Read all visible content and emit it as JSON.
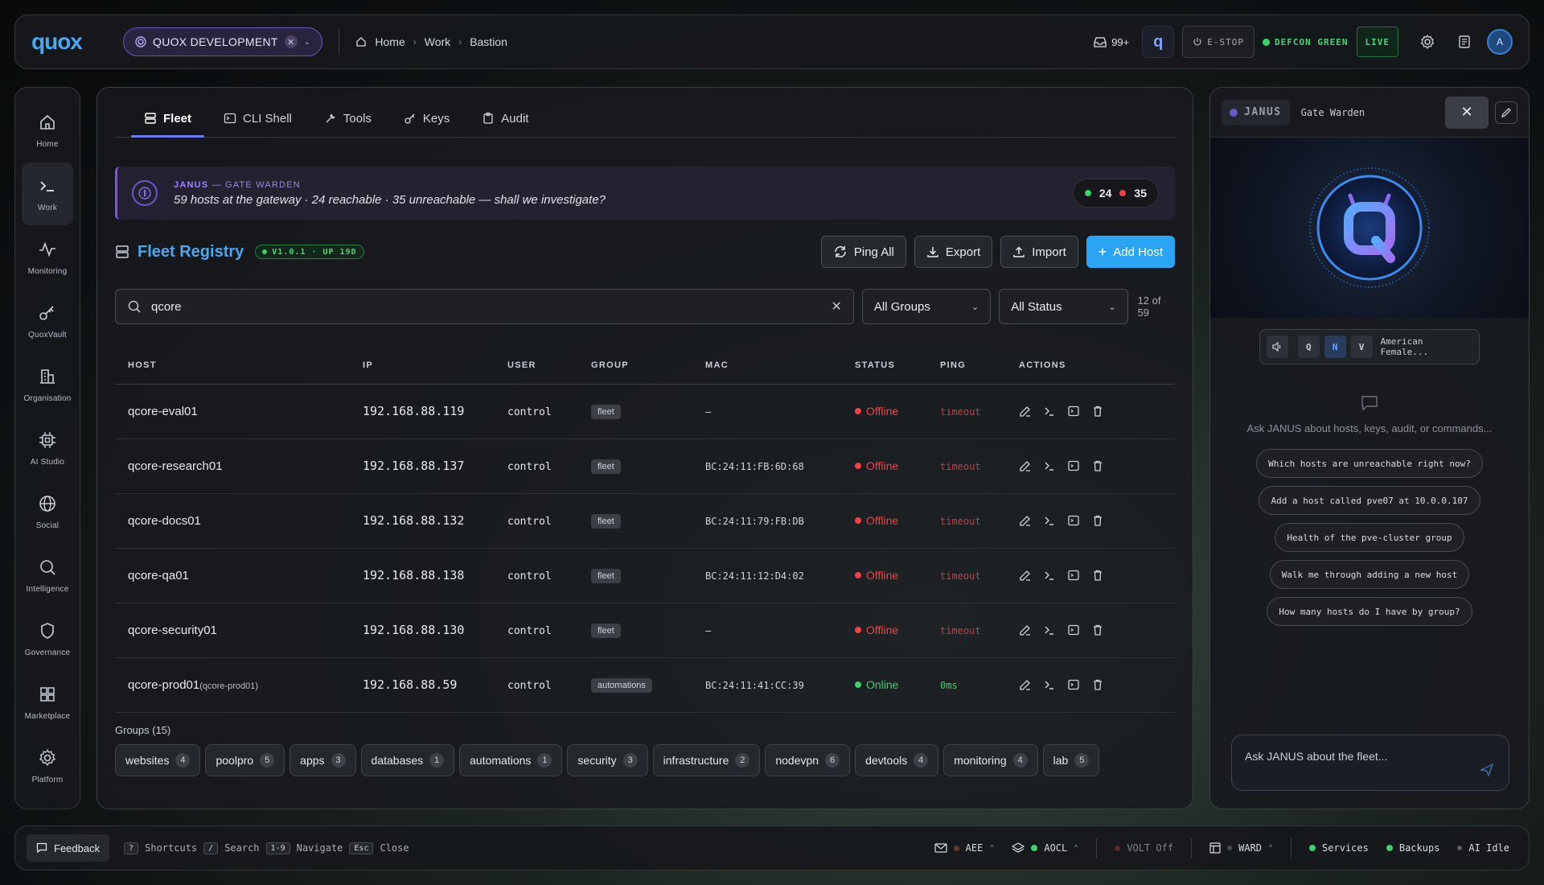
{
  "topbar": {
    "logo": "quox",
    "workspace": "QUOX DEVELOPMENT",
    "breadcrumbs": [
      "Home",
      "Work",
      "Bastion"
    ],
    "inbox_count": "99+",
    "estop": "E-STOP",
    "defcon": "DEFCON GREEN",
    "live": "LIVE",
    "avatar": "A"
  },
  "leftnav": {
    "items": [
      {
        "label": "Home",
        "icon": "home-icon"
      },
      {
        "label": "Work",
        "icon": "terminal-icon",
        "active": true
      },
      {
        "label": "Monitoring",
        "icon": "pulse-icon"
      },
      {
        "label": "QuoxVault",
        "icon": "key-icon"
      },
      {
        "label": "Organisation",
        "icon": "building-icon"
      },
      {
        "label": "AI Studio",
        "icon": "chip-icon"
      },
      {
        "label": "Social",
        "icon": "globe-icon"
      },
      {
        "label": "Intelligence",
        "icon": "search-icon"
      },
      {
        "label": "Governance",
        "icon": "shield-icon"
      },
      {
        "label": "Marketplace",
        "icon": "grid-icon"
      },
      {
        "label": "Platform",
        "icon": "gear-icon"
      }
    ]
  },
  "tabs": [
    "Fleet",
    "CLI Shell",
    "Tools",
    "Keys",
    "Audit"
  ],
  "banner": {
    "name": "JANUS",
    "role": "— GATE WARDEN",
    "message": "59 hosts at the gateway · 24 reachable · 35 unreachable — shall we investigate?",
    "reachable": "24",
    "unreachable": "35"
  },
  "registry": {
    "title": "Fleet Registry",
    "version_badge": "V1.0.1 · UP 19D",
    "actions": {
      "ping_all": "Ping All",
      "export": "Export",
      "import": "Import",
      "add_host": "Add Host"
    }
  },
  "filters": {
    "search_value": "qcore",
    "groups_select": "All Groups",
    "status_select": "All Status",
    "result_count": "12 of 59"
  },
  "table": {
    "columns": [
      "HOST",
      "IP",
      "USER",
      "GROUP",
      "MAC",
      "STATUS",
      "PING",
      "ACTIONS"
    ],
    "rows": [
      {
        "host": "qcore-eval01",
        "sub": "",
        "ip": "192.168.88.119",
        "user": "control",
        "group": "fleet",
        "mac": "–",
        "status": "Offline",
        "ping": "timeout"
      },
      {
        "host": "qcore-research01",
        "sub": "",
        "ip": "192.168.88.137",
        "user": "control",
        "group": "fleet",
        "mac": "BC:24:11:FB:6D:68",
        "status": "Offline",
        "ping": "timeout"
      },
      {
        "host": "qcore-docs01",
        "sub": "",
        "ip": "192.168.88.132",
        "user": "control",
        "group": "fleet",
        "mac": "BC:24:11:79:FB:DB",
        "status": "Offline",
        "ping": "timeout"
      },
      {
        "host": "qcore-qa01",
        "sub": "",
        "ip": "192.168.88.138",
        "user": "control",
        "group": "fleet",
        "mac": "BC:24:11:12:D4:02",
        "status": "Offline",
        "ping": "timeout"
      },
      {
        "host": "qcore-security01",
        "sub": "",
        "ip": "192.168.88.130",
        "user": "control",
        "group": "fleet",
        "mac": "–",
        "status": "Offline",
        "ping": "timeout"
      },
      {
        "host": "qcore-prod01",
        "sub": "(qcore-prod01)",
        "ip": "192.168.88.59",
        "user": "control",
        "group": "automations",
        "mac": "BC:24:11:41:CC:39",
        "status": "Online",
        "ping": "0ms"
      }
    ]
  },
  "groups": {
    "label": "Groups (15)",
    "chips": [
      {
        "name": "websites",
        "count": "4"
      },
      {
        "name": "poolpro",
        "count": "5"
      },
      {
        "name": "apps",
        "count": "3"
      },
      {
        "name": "databases",
        "count": "1"
      },
      {
        "name": "automations",
        "count": "1"
      },
      {
        "name": "security",
        "count": "3"
      },
      {
        "name": "infrastructure",
        "count": "2"
      },
      {
        "name": "nodevpn",
        "count": "6"
      },
      {
        "name": "devtools",
        "count": "4"
      },
      {
        "name": "monitoring",
        "count": "4"
      },
      {
        "name": "lab",
        "count": "5"
      }
    ]
  },
  "assistant": {
    "name": "JANUS",
    "role": "Gate Warden",
    "voice_modes": [
      "Q",
      "N",
      "V"
    ],
    "voice_name": "American Female...",
    "hint": "Ask JANUS about hosts, keys, audit, or commands...",
    "suggestions": [
      "Which hosts are unreachable right now?",
      "Add a host called pve07 at 10.0.0.107",
      "Health of the pve-cluster group",
      "Walk me through adding a new host",
      "How many hosts do I have by group?"
    ],
    "input_placeholder": "Ask JANUS about the fleet..."
  },
  "bottombar": {
    "feedback": "Feedback",
    "shortcuts": [
      {
        "key": "?",
        "label": "Shortcuts"
      },
      {
        "key": "/",
        "label": "Search"
      },
      {
        "key": "1-9",
        "label": "Navigate"
      },
      {
        "key": "Esc",
        "label": "Close"
      }
    ],
    "status": {
      "aee": "AEE",
      "aocl": "AOCL",
      "volt": "VOLT Off",
      "ward": "WARD",
      "services": "Services",
      "backups": "Backups",
      "ai": "AI Idle"
    }
  },
  "colors": {
    "accent": "#4aa8f0",
    "primary_button": "#2ba4f4",
    "online": "#3ecf6e",
    "offline": "#f0424a",
    "janus_purple": "#7b55e0"
  }
}
